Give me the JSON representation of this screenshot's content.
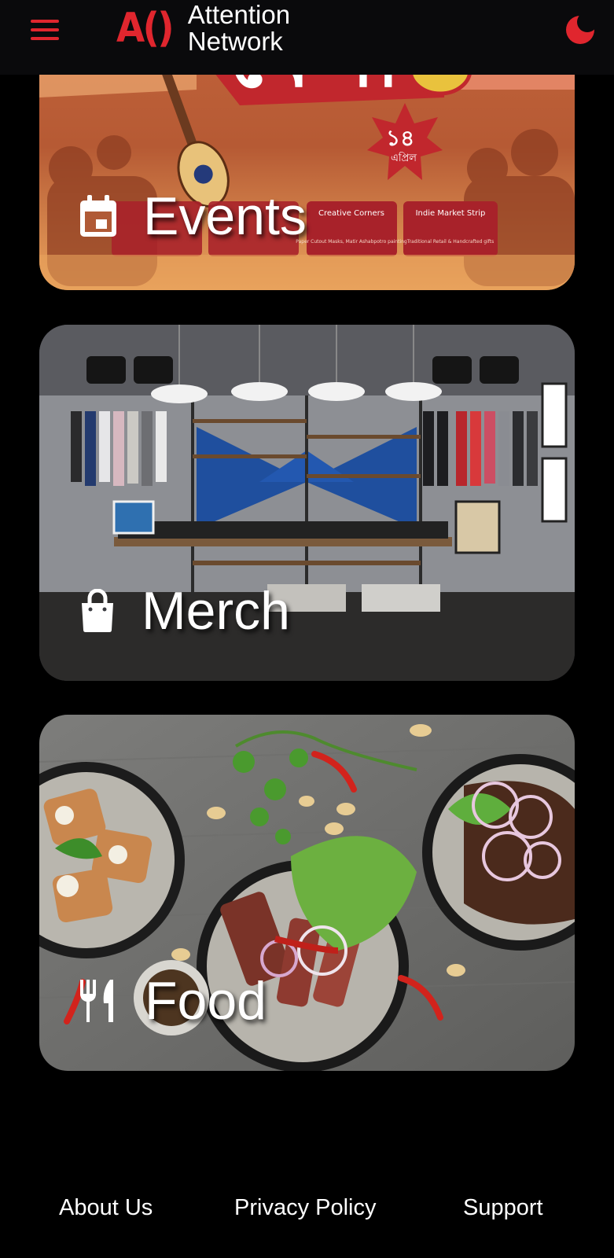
{
  "header": {
    "logo_mark": "A()",
    "logo_line1": "Attention",
    "logo_line2": "Network",
    "menu_icon": "hamburger-icon",
    "theme_icon": "moon-icon"
  },
  "cards": {
    "events": {
      "label": "Events",
      "icon": "calendar-icon"
    },
    "merch": {
      "label": "Merch",
      "icon": "shopping-bag-icon"
    },
    "food": {
      "label": "Food",
      "icon": "utensils-icon"
    }
  },
  "events_banner": {
    "badge": "১৪",
    "badge_sub": "এপ্রিল",
    "strips": [
      {
        "title": "Creative Corners",
        "sub": "Paper Cutout Masks, Matir Ashabpotro painting"
      },
      {
        "title": "Indie Market Strip",
        "sub": "Traditional Retail & Handcrafted gifts"
      }
    ]
  },
  "footer": {
    "about": "About Us",
    "privacy": "Privacy Policy",
    "support": "Support"
  },
  "colors": {
    "accent": "#e0262e",
    "background": "#000000",
    "header_bg": "#0a0a0c"
  }
}
